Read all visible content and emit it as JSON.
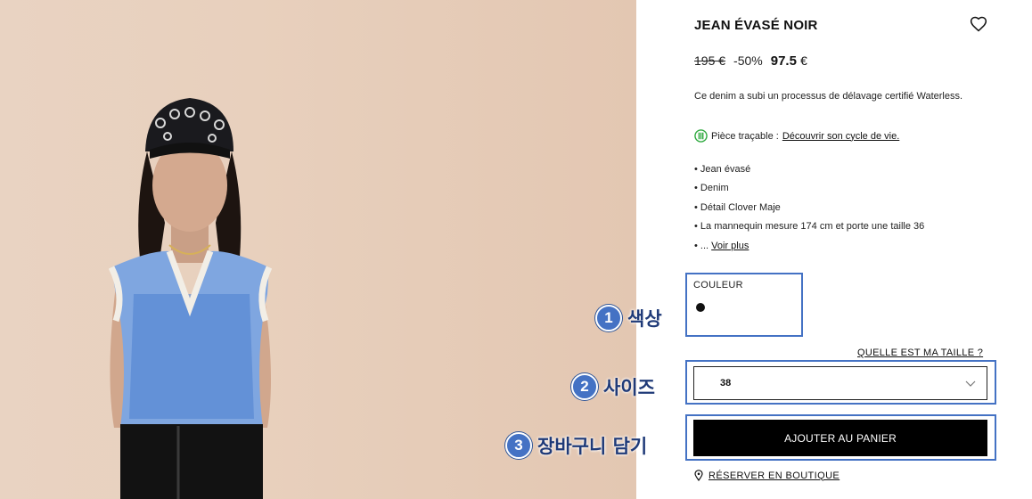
{
  "product": {
    "title": "JEAN ÉVASÉ NOIR",
    "old_price": "195 €",
    "discount": "-50%",
    "new_price": "97.5",
    "currency": "€",
    "description": "Ce denim a subi un processus de délavage certifié Waterless.",
    "traceable_label": "Pièce traçable :",
    "traceable_link": "Découvrir son cycle de vie.",
    "bullets": [
      "Jean évasé",
      "Denim",
      "Détail Clover Maje",
      "La mannequin mesure 174 cm et porte une taille 36"
    ],
    "more_prefix": "...",
    "more_link": "Voir plus"
  },
  "color": {
    "label": "COULEUR",
    "selected": "#111111"
  },
  "size": {
    "guide_link": "QUELLE EST MA TAILLE ?",
    "selected": "38"
  },
  "cart": {
    "button_label": "AJOUTER AU PANIER"
  },
  "reserve": {
    "label": "RÉSERVER EN BOUTIQUE"
  },
  "annotations": [
    {
      "num": "1",
      "text": "색상"
    },
    {
      "num": "2",
      "text": "사이즈"
    },
    {
      "num": "3",
      "text": "장바구니 담기"
    }
  ],
  "colors": {
    "accent_box": "#4472c4",
    "button_bg": "#000000",
    "photo_bg": "#e8d0bd"
  },
  "icons": [
    "heart-icon",
    "leaf-icon",
    "chevron-down-icon",
    "location-pin-icon"
  ]
}
